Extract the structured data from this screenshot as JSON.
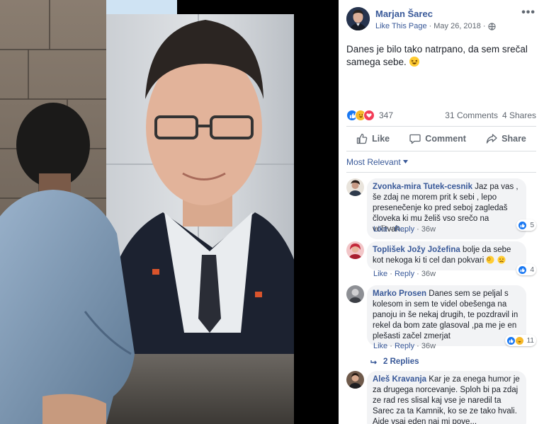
{
  "post": {
    "page_name": "Marjan Šarec",
    "like_link": "Like This Page",
    "date": "May 26, 2018",
    "separator": "·",
    "text": "Danes je bilo tako natrpano, da sem srečal samega sebe.",
    "reactions_count": "347",
    "comments_count": "31 Comments",
    "shares_count": "4 Shares"
  },
  "actions": {
    "like": "Like",
    "comment": "Comment",
    "share": "Share"
  },
  "filter": {
    "label": "Most Relevant"
  },
  "comments": [
    {
      "name": "Zvonka-mira Tutek-cesnik",
      "text": "Jaz pa vas , še zdaj ne morem prit k sebi , lepo presenečenje ko pred seboj zagledaš človeka ki mu želiš vso srečo na volitvah...",
      "like": "Like",
      "reply": "Reply",
      "time": "36w",
      "reacts": "5"
    },
    {
      "name": "Toplišek Jožy Jožefina",
      "text": "bolje da sebe kot nekoga ki ti cel dan pokvari",
      "like": "Like",
      "reply": "Reply",
      "time": "36w",
      "reacts": "4"
    },
    {
      "name": "Marko Prosen",
      "text": "Danes sem se peljal s kolesom in sem te videl obešenga na panoju in še nekaj drugih, te pozdravil in rekel da bom zate glasoval ,pa me je en plešasti začel zmerjat",
      "like": "Like",
      "reply": "Reply",
      "time": "36w",
      "reacts": "11",
      "replies_label": "2 Replies"
    },
    {
      "name": "Aleš Kravanja",
      "text": "Kar je za enega humor je za drugega norcevanje. Sploh bi pa zdaj ze rad res slisal kaj vse je naredil ta Sarec za ta Kamnik, ko se ze tako hvali. Ajde vsaj eden naj mi pove..."
    }
  ],
  "colors": {
    "link": "#385898",
    "muted": "#606770",
    "like_blue": "#1877f2",
    "haha_yellow": "#f7b928",
    "love_red": "#f33e58",
    "bubble": "#f2f3f5"
  },
  "icons": {
    "more": "more-dots-icon",
    "globe": "globe-icon",
    "like": "thumbs-up-icon",
    "comment": "speech-bubble-icon",
    "share": "share-arrow-icon",
    "dropdown": "caret-down-icon",
    "reply": "reply-arrow-icon"
  }
}
